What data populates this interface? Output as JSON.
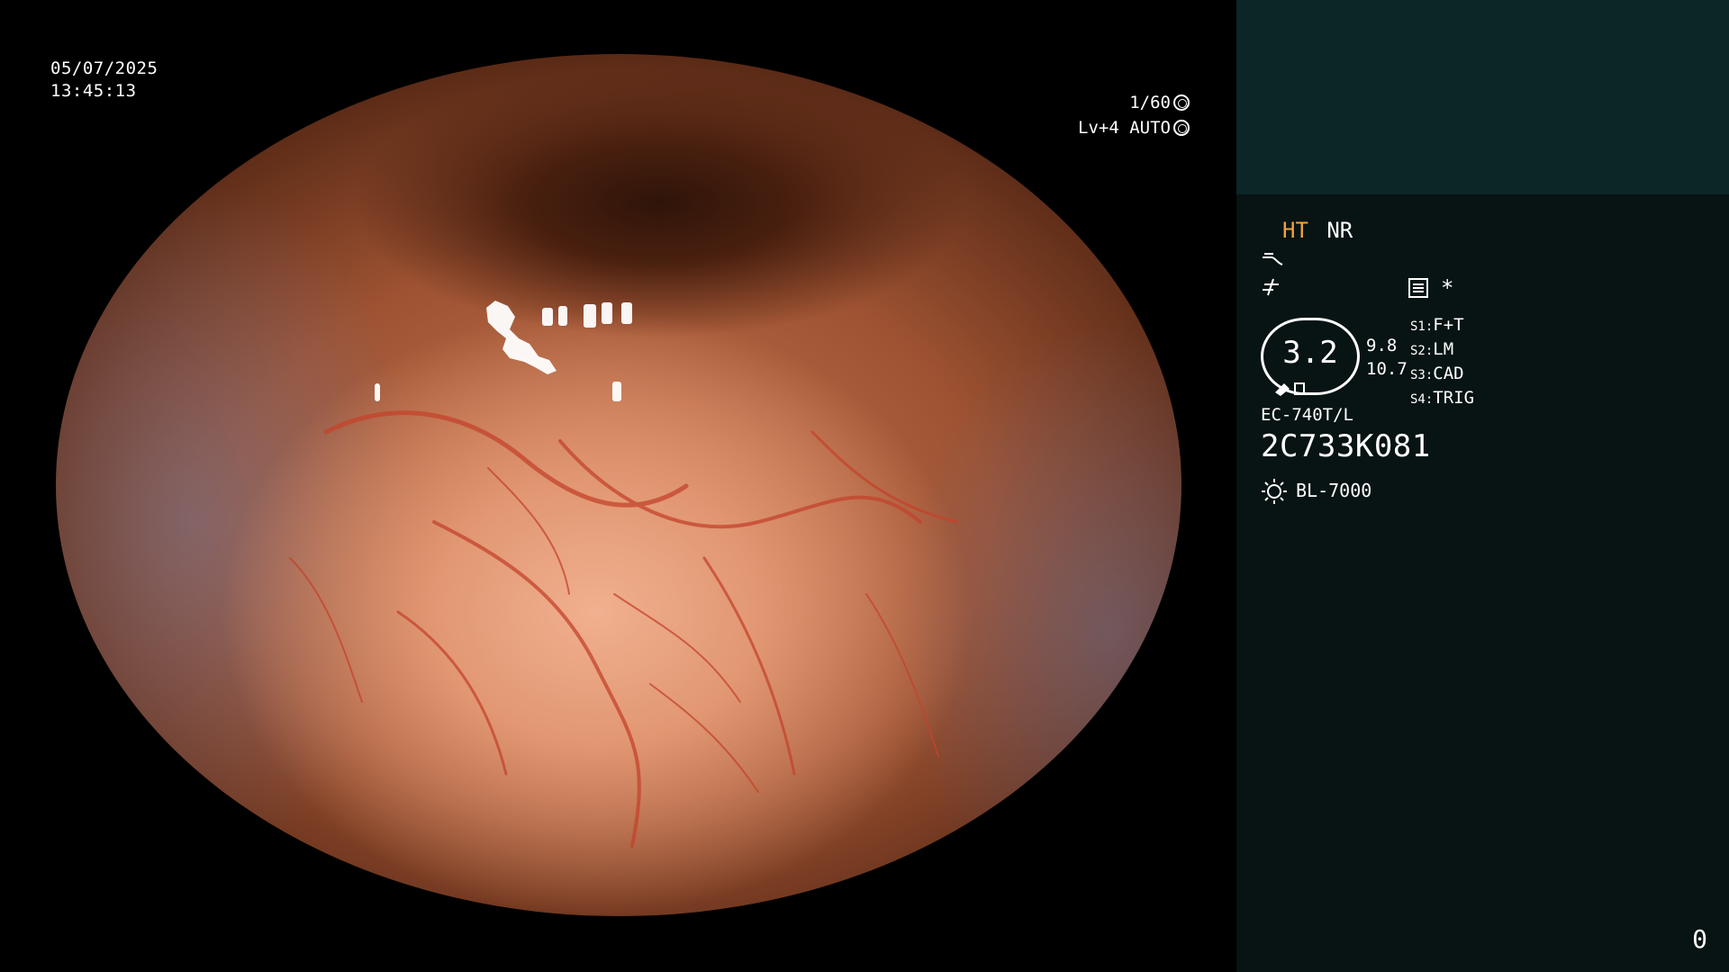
{
  "osd": {
    "date": "05/07/2025",
    "time": "13:45:13",
    "shutter": "1/60",
    "level": "Lv+4 AUTO"
  },
  "panel": {
    "mode_ht": "HT",
    "mode_nr": "NR",
    "zoom": "3.2",
    "zoom_values": [
      "9.8",
      "10.7"
    ],
    "scope_model": "EC-740T/L",
    "serial": "2C733K081",
    "light_source": "BL-7000",
    "asterisk": "*",
    "switches": [
      {
        "key": "S1:",
        "value": "F+T"
      },
      {
        "key": "S2:",
        "value": "LM"
      },
      {
        "key": "S3:",
        "value": "CAD"
      },
      {
        "key": "S4:",
        "value": "TRIG"
      }
    ],
    "counter": "0"
  },
  "colors": {
    "accent_ht": "#f0a43c",
    "panel_bg": "#081314",
    "panel_top_bg": "#0c2628"
  },
  "icons": [
    "aperture-icon",
    "iris-icon",
    "wave-icon",
    "sharpness-icon",
    "settings-list-icon",
    "sun-lamp-icon"
  ]
}
